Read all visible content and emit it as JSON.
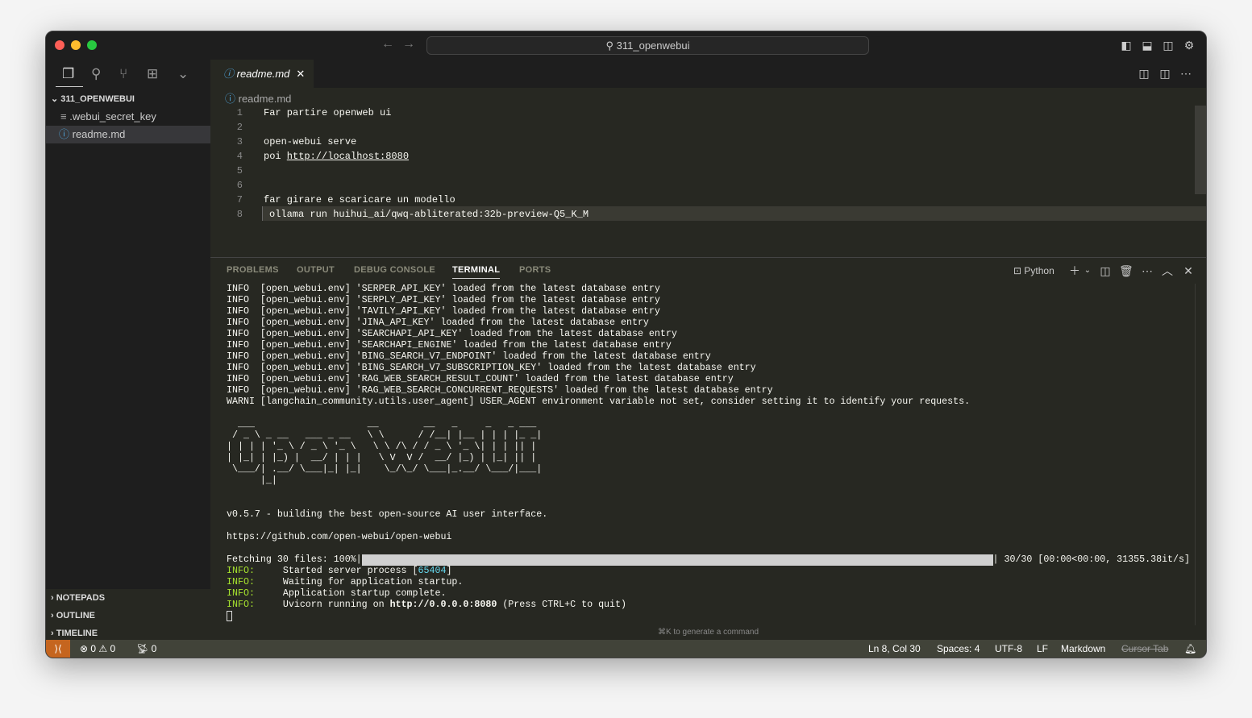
{
  "window": {
    "search": "311_openwebui"
  },
  "sidebar": {
    "root": "311_OPENWEBUI",
    "files": [
      ".webui_secret_key",
      "readme.md"
    ],
    "sections": [
      "NOTEPADS",
      "OUTLINE",
      "TIMELINE"
    ]
  },
  "editor": {
    "tab": "readme.md",
    "breadcrumb": "readme.md",
    "lines": [
      "Far partire openweb ui",
      "",
      "open-webui serve",
      "poi ",
      "",
      "",
      "far girare e scaricare un modello",
      "ollama run huihui_ai/qwq-abliterated:32b-preview-Q5_K_M"
    ],
    "link": "http://localhost:8080"
  },
  "panel": {
    "tabs": [
      "PROBLEMS",
      "OUTPUT",
      "DEBUG CONSOLE",
      "TERMINAL",
      "PORTS"
    ],
    "active_tab": "TERMINAL",
    "shell": "Python",
    "hint": "⌘K to generate a command"
  },
  "terminal": {
    "env_lines": [
      "INFO  [open_webui.env] 'SERPER_API_KEY' loaded from the latest database entry",
      "INFO  [open_webui.env] 'SERPLY_API_KEY' loaded from the latest database entry",
      "INFO  [open_webui.env] 'TAVILY_API_KEY' loaded from the latest database entry",
      "INFO  [open_webui.env] 'JINA_API_KEY' loaded from the latest database entry",
      "INFO  [open_webui.env] 'SEARCHAPI_API_KEY' loaded from the latest database entry",
      "INFO  [open_webui.env] 'SEARCHAPI_ENGINE' loaded from the latest database entry",
      "INFO  [open_webui.env] 'BING_SEARCH_V7_ENDPOINT' loaded from the latest database entry",
      "INFO  [open_webui.env] 'BING_SEARCH_V7_SUBSCRIPTION_KEY' loaded from the latest database entry",
      "INFO  [open_webui.env] 'RAG_WEB_SEARCH_RESULT_COUNT' loaded from the latest database entry",
      "INFO  [open_webui.env] 'RAG_WEB_SEARCH_CONCURRENT_REQUESTS' loaded from the latest database entry",
      "WARNI [langchain_community.utils.user_agent] USER_AGENT environment variable not set, consider setting it to identify your requests."
    ],
    "ascii_art": [
      "  ___                    __        __   _     _   _ ___ ",
      " / _ \\ _ __   ___ _ __   \\ \\      / /__| |__ | | | |_ _|",
      "| | | | '_ \\ / _ \\ '_ \\   \\ \\ /\\ / / _ \\ '_ \\| | | || | ",
      "| |_| | |_) |  __/ | | |   \\ V  V /  __/ |_) | |_| || | ",
      " \\___/| .__/ \\___|_| |_|    \\_/\\_/ \\___|_.__/ \\___/|___|",
      "      |_|                                               "
    ],
    "version": "v0.5.7 - building the best open-source AI user interface.",
    "repo": "https://github.com/open-webui/open-webui",
    "fetch_prefix": "Fetching 30 files: 100%|",
    "fetch_progress": 1.0,
    "fetch_suffix": "| 30/30 [00:00<00:00, 31355.38it/s]",
    "uvicorn": [
      {
        "level": "INFO:",
        "text": "     Started server process [",
        "pid": "65404",
        "end": "]"
      },
      {
        "level": "INFO:",
        "text": "     Waiting for application startup."
      },
      {
        "level": "INFO:",
        "text": "     Application startup complete."
      },
      {
        "level": "INFO:",
        "text": "     Uvicorn running on ",
        "bold": "http://0.0.0.0:8080",
        "end": " (Press CTRL+C to quit)"
      }
    ]
  },
  "status": {
    "errors": "0",
    "warnings": "0",
    "ports": "0",
    "position": "Ln 8, Col 30",
    "spaces": "Spaces: 4",
    "encoding": "UTF-8",
    "eol": "LF",
    "language": "Markdown",
    "cursor_tab": "Cursor Tab"
  }
}
